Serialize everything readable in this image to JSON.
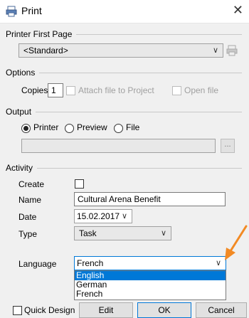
{
  "window": {
    "title": "Print",
    "close_glyph": "✕"
  },
  "printer_group": {
    "legend": "Printer First Page",
    "combo_value": "<Standard>"
  },
  "options_group": {
    "legend": "Options",
    "copies_label": "Copies",
    "copies_value": "1",
    "attach_label": "Attach file to Project",
    "open_label": "Open file"
  },
  "output_group": {
    "legend": "Output",
    "radios": [
      {
        "label": "Printer",
        "checked": true
      },
      {
        "label": "Preview",
        "checked": false
      },
      {
        "label": "File",
        "checked": false
      }
    ],
    "path_value": "",
    "browse_label": "..."
  },
  "activity_group": {
    "legend": "Activity",
    "create_label": "Create",
    "name_label": "Name",
    "name_value": "Cultural Arena Benefit",
    "date_label": "Date",
    "date_value": "15.02.2017",
    "type_label": "Type",
    "type_value": "Task",
    "language_label": "Language",
    "language_value": "French",
    "language_options": [
      "English",
      "German",
      "French"
    ]
  },
  "footer": {
    "quick_design_label": "Quick Design",
    "edit_label": "Edit",
    "ok_label": "OK",
    "cancel_label": "Cancel"
  },
  "colors": {
    "accent": "#0078d7",
    "annotation_arrow": "#f28a24"
  }
}
